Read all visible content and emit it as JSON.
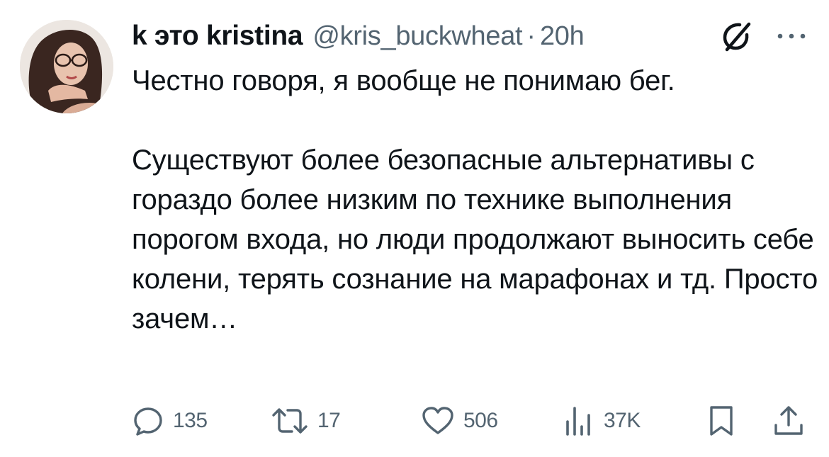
{
  "author": {
    "display_name": "k это kristina",
    "handle": "@kris_buckwheat",
    "separator": "·",
    "time": "20h"
  },
  "header_icons": {
    "grok": "grok-icon",
    "more": "more-dots-icon"
  },
  "tweet": {
    "text": "Честно говоря, я вообще не понимаю бег.\n\nСуществуют более безопасные альтернативы с гораздо более низким по технике выполнения порогом входа, но люди продолжают выносить себе колени, терять сознание на марафонах и тд. Просто зачем…"
  },
  "actions": {
    "replies": "135",
    "retweets": "17",
    "likes": "506",
    "views": "37K",
    "icons": [
      "reply-icon",
      "retweet-icon",
      "like-icon",
      "views-icon",
      "bookmark-icon",
      "share-icon"
    ]
  },
  "colors": {
    "text": "#0f1419",
    "secondary": "#536471",
    "background": "#ffffff"
  }
}
